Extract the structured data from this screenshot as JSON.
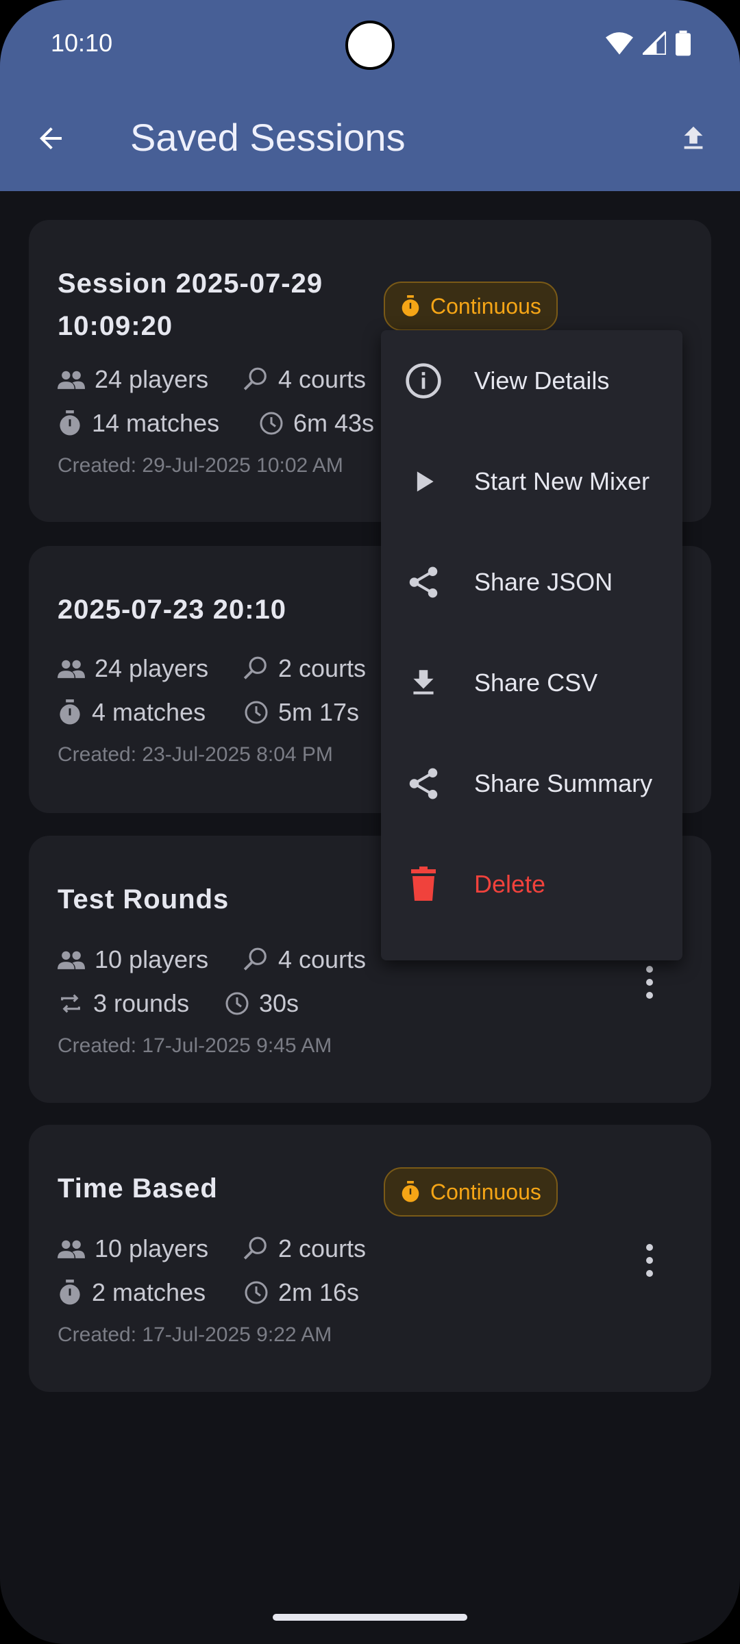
{
  "status": {
    "time": "10:10"
  },
  "appbar": {
    "title": "Saved Sessions"
  },
  "sessions": [
    {
      "title_line1": "Session 2025-07-29",
      "title_line2": "10:09:20",
      "badge": "Continuous",
      "players": "24 players",
      "courts": "4 courts",
      "matches": "14 matches",
      "duration": "6m 43s",
      "created": "Created: 29-Jul-2025 10:02 AM"
    },
    {
      "title": "2025-07-23 20:10",
      "players": "24 players",
      "courts": "2 courts",
      "matches": "4 matches",
      "duration": "5m 17s",
      "created": "Created: 23-Jul-2025 8:04 PM"
    },
    {
      "title": "Test Rounds",
      "players": "10 players",
      "courts": "4 courts",
      "rounds": "3 rounds",
      "duration": "30s",
      "created": "Created: 17-Jul-2025 9:45 AM"
    },
    {
      "title": "Time Based",
      "badge": "Continuous",
      "players": "10 players",
      "courts": "2 courts",
      "matches": "2 matches",
      "duration": "2m 16s",
      "created": "Created: 17-Jul-2025 9:22 AM"
    }
  ],
  "menu": {
    "items": [
      {
        "label": "View Details",
        "icon": "info-icon"
      },
      {
        "label": "Start New Mixer",
        "icon": "play-icon"
      },
      {
        "label": "Share JSON",
        "icon": "share-icon"
      },
      {
        "label": "Share CSV",
        "icon": "download-icon"
      },
      {
        "label": "Share Summary",
        "icon": "share-icon"
      },
      {
        "label": "Delete",
        "icon": "trash-icon"
      }
    ]
  },
  "colors": {
    "appbar": "#475f96",
    "background": "#121318",
    "card": "#1e1f25",
    "badge_accent": "#f5a516",
    "danger": "#f0423c"
  }
}
